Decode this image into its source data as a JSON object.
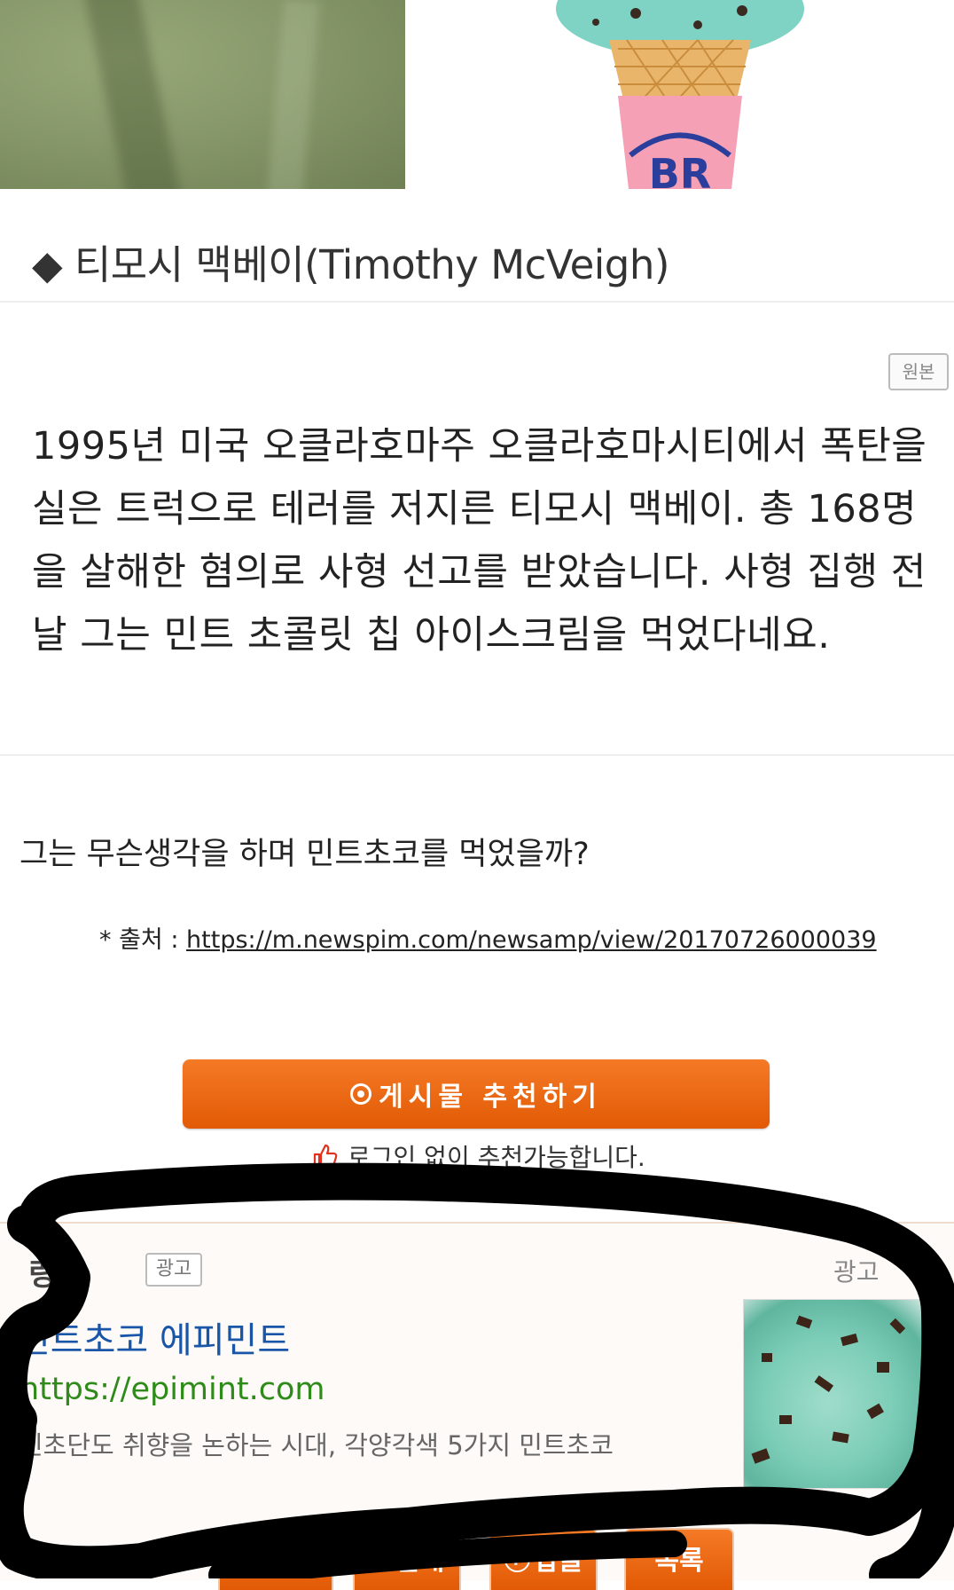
{
  "post": {
    "section_heading": "◆ 티모시 맥베이(Timothy McVeigh)",
    "original_label": "원본",
    "body": "1995년 미국 오클라호마주 오클라호마시티에서 폭탄을 실은 트럭으로 테러를 저지른 티모시 맥베이. 총 168명을 살해한 혐의로 사형 선고를 받았습니다. 사형 집행 전날 그는 민트 초콜릿 칩 아이스크림을 먹었다네요.",
    "question": "그는 무슨생각을 하며 민트초코를 먹었을까?",
    "source_prefix": "* 출처 : ",
    "source_url": "https://m.newspim.com/newsamp/view/20170726000039"
  },
  "recommend": {
    "button_label": "게시물 추천하기",
    "note": "로그인 없이 추천가능합니다."
  },
  "ad": {
    "section_label": "링크",
    "badge": "광고",
    "info": "광고",
    "title": "민트초코 에피민트",
    "url": "https://epimint.com",
    "description": "민초단도 취향을 논하는 시대, 각양각색 5가지 민트초코"
  },
  "bottom_bar": {
    "oppose_label": "반대",
    "reply_label": "답글",
    "list_label": "목록"
  },
  "images": {
    "logo_text": "BR"
  },
  "colors": {
    "accent": "#e96a12",
    "ad_title": "#1a56a8",
    "ad_url": "#2e8b1a"
  }
}
